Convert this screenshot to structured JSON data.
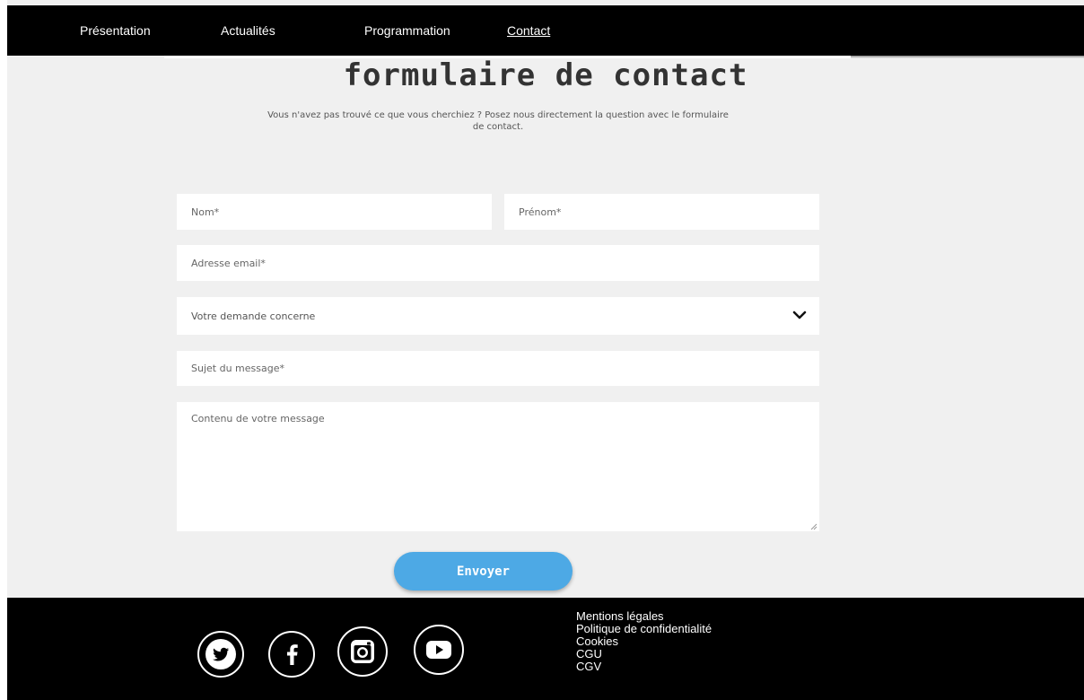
{
  "nav": {
    "items": [
      {
        "label": "Présentation"
      },
      {
        "label": "Actualités"
      },
      {
        "label": "Programmation"
      },
      {
        "label": "Contact"
      }
    ]
  },
  "page": {
    "title": "formulaire de contact",
    "subtitle": "Vous n'avez pas trouvé ce que vous cherchiez ? Posez nous directement la question avec le formulaire de contact."
  },
  "form": {
    "last_name": {
      "placeholder": "Nom*",
      "value": ""
    },
    "first_name": {
      "placeholder": "Prénom*",
      "value": ""
    },
    "email": {
      "placeholder": "Adresse email*",
      "value": ""
    },
    "request_type": {
      "selected": "Votre demande concerne"
    },
    "subject": {
      "placeholder": "Sujet du message*",
      "value": ""
    },
    "message": {
      "placeholder": "Contenu de votre message",
      "value": ""
    },
    "submit_label": "Envoyer"
  },
  "footer": {
    "social": [
      {
        "icon": "twitter-icon"
      },
      {
        "icon": "facebook-icon"
      },
      {
        "icon": "instagram-icon"
      },
      {
        "icon": "youtube-icon"
      }
    ],
    "links": [
      {
        "label": "Mentions légales"
      },
      {
        "label": "Politique de confidentialité"
      },
      {
        "label": "Cookies"
      },
      {
        "label": "CGU"
      },
      {
        "label": "CGV"
      }
    ]
  },
  "colors": {
    "nav_bg": "#000000",
    "page_bg": "#f0f0f0",
    "button": "#4da9e5",
    "footer_bg": "#000000"
  }
}
